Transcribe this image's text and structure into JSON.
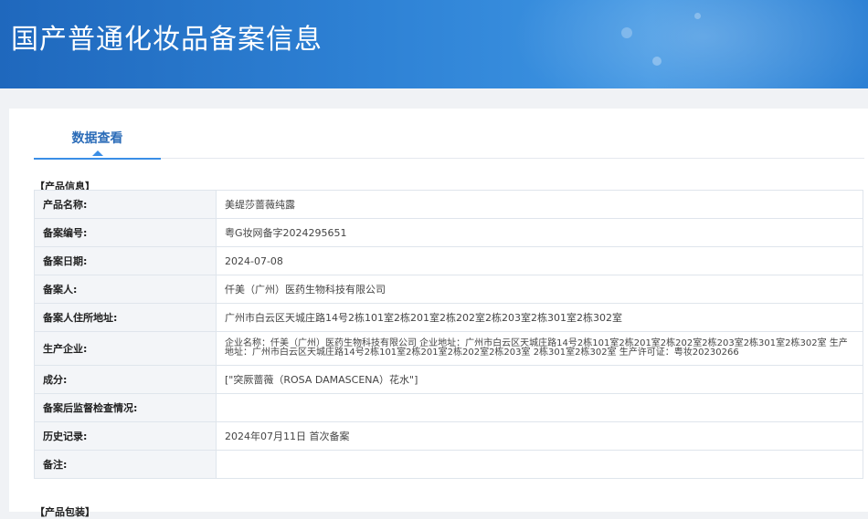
{
  "header": {
    "title": "国产普通化妆品备案信息"
  },
  "tabs": [
    {
      "label": "数据查看"
    }
  ],
  "product_info": {
    "section_title": "【产品信息】",
    "rows": [
      {
        "label": "产品名称:",
        "value": "美缇莎蔷薇纯露"
      },
      {
        "label": "备案编号:",
        "value": "粤G妆网备字2024295651"
      },
      {
        "label": "备案日期:",
        "value": "2024-07-08"
      },
      {
        "label": "备案人:",
        "value": "仟美（广州）医药生物科技有限公司"
      },
      {
        "label": "备案人住所地址:",
        "value": "广州市白云区天城庄路14号2栋101室2栋201室2栋202室2栋203室2栋301室2栋302室"
      },
      {
        "label": "生产企业:",
        "value": "企业名称：仟美（广州）医药生物科技有限公司 企业地址：广州市白云区天城庄路14号2栋101室2栋201室2栋202室2栋203室2栋301室2栋302室 生产地址：广州市白云区天城庄路14号2栋101室2栋201室2栋202室2栋203室 2栋301室2栋302室 生产许可证：粤妆20230266"
      },
      {
        "label": "成分:",
        "value": "[\"突厥蔷薇（ROSA DAMASCENA）花水\"]"
      },
      {
        "label": "备案后监督检查情况:",
        "value": ""
      },
      {
        "label": "历史记录:",
        "value": "2024年07月11日 首次备案"
      },
      {
        "label": "备注:",
        "value": ""
      }
    ]
  },
  "packaging": {
    "section_title": "【产品包装】"
  }
}
